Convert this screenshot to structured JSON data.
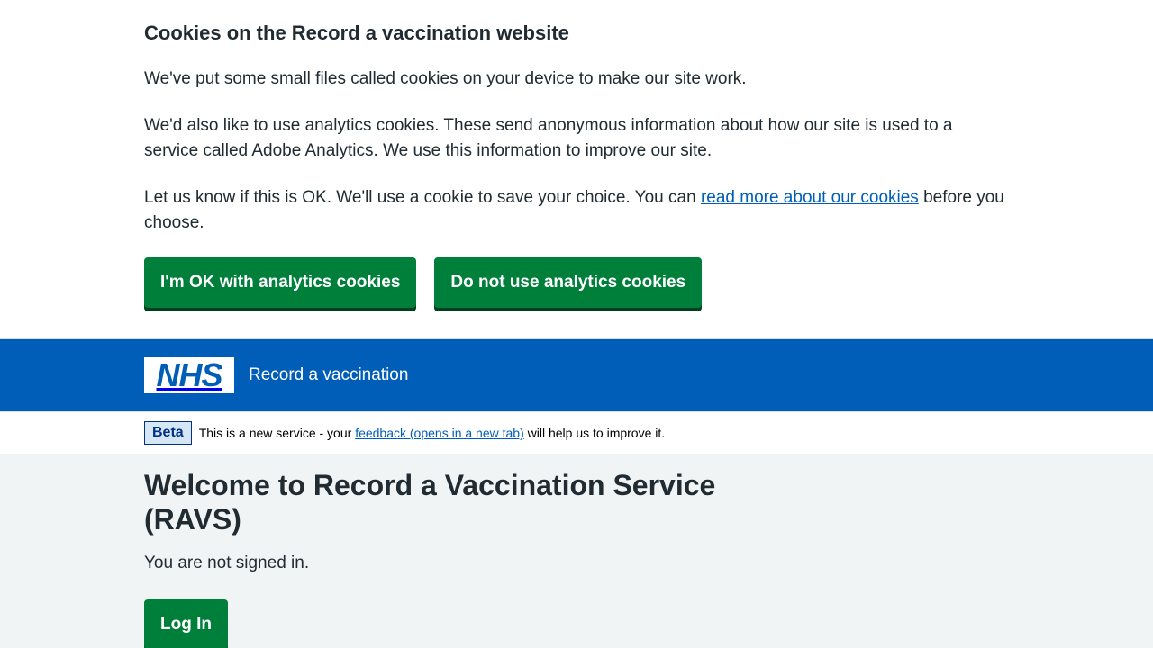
{
  "cookie_banner": {
    "title": "Cookies on the Record a vaccination website",
    "p1": "We've put some small files called cookies on your device to make our site work.",
    "p2": "We'd also like to use analytics cookies. These send anonymous information about how our site is used to a service called Adobe Analytics. We use this information to improve our site.",
    "p3_before": "Let us know if this is OK. We'll use a cookie to save your choice. You can ",
    "p3_link": "read more about our cookies",
    "p3_after": " before you choose.",
    "accept_label": "I'm OK with analytics cookies",
    "reject_label": "Do not use analytics cookies"
  },
  "header": {
    "logo_text": "NHS",
    "service_name": "Record a vaccination"
  },
  "phase_banner": {
    "tag": "Beta",
    "text_before": "This is a new service - your ",
    "link": "feedback (opens in a new tab)",
    "text_after": " will help us to improve it."
  },
  "main": {
    "title": "Welcome to Record a Vaccination Service (RAVS)",
    "status": "You are not signed in.",
    "login_label": "Log In"
  },
  "colors": {
    "nhs_blue": "#005eb8",
    "button_green": "#007f3b",
    "background": "#f0f4f5"
  }
}
